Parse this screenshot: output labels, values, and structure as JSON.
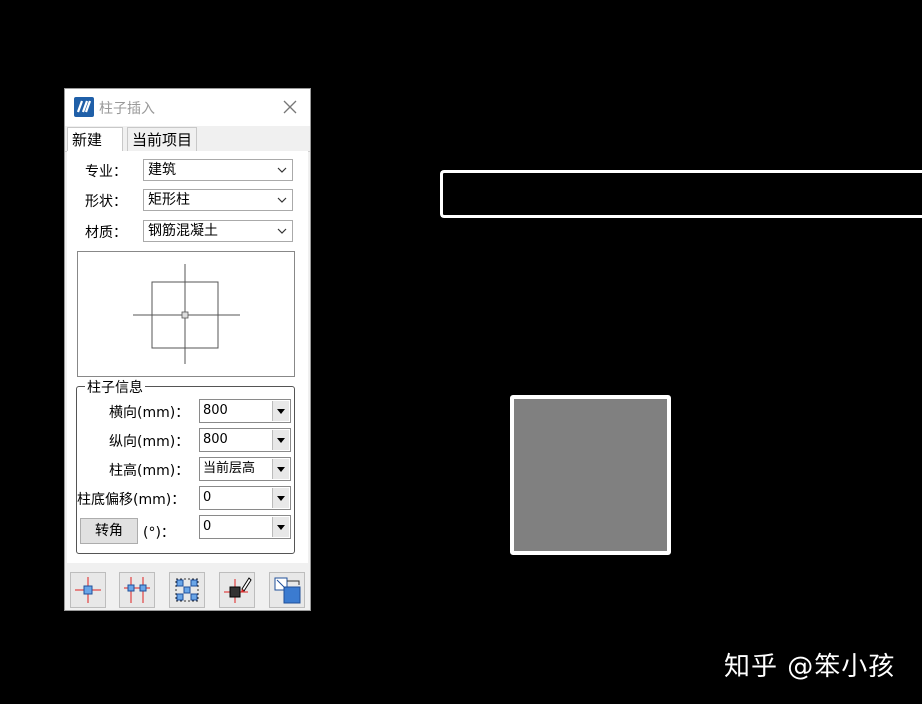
{
  "dialog": {
    "title": "柱子插入",
    "tabs": [
      {
        "label": "新建"
      },
      {
        "label": "当前项目"
      }
    ],
    "fields": {
      "discipline": {
        "label": "专业：",
        "value": "建筑"
      },
      "shape": {
        "label": "形状：",
        "value": "矩形柱"
      },
      "material": {
        "label": "材质：",
        "value": "钢筋混凝土"
      }
    },
    "column_info": {
      "title": "柱子信息",
      "horizontal": {
        "label": "横向(mm)：",
        "value": "800"
      },
      "vertical": {
        "label": "纵向(mm)：",
        "value": "800"
      },
      "height": {
        "label": "柱高(mm)：",
        "value": "当前层高"
      },
      "base_offset": {
        "label": "柱底偏移(mm)：",
        "value": "0"
      },
      "rotation": {
        "button_label": "转角",
        "label": "(°)：",
        "value": "0"
      }
    },
    "toolbar": [
      {
        "icon": "point-insert-icon"
      },
      {
        "icon": "axis-intersection-insert-icon"
      },
      {
        "icon": "region-insert-icon"
      },
      {
        "icon": "replace-column-icon"
      },
      {
        "icon": "corner-fit-icon"
      }
    ]
  },
  "watermark": "知乎 @笨小孩",
  "colors": {
    "canvas": "#000000",
    "wall": "#ffffff",
    "column_fill": "#808080",
    "accent_red": "#e02020"
  }
}
